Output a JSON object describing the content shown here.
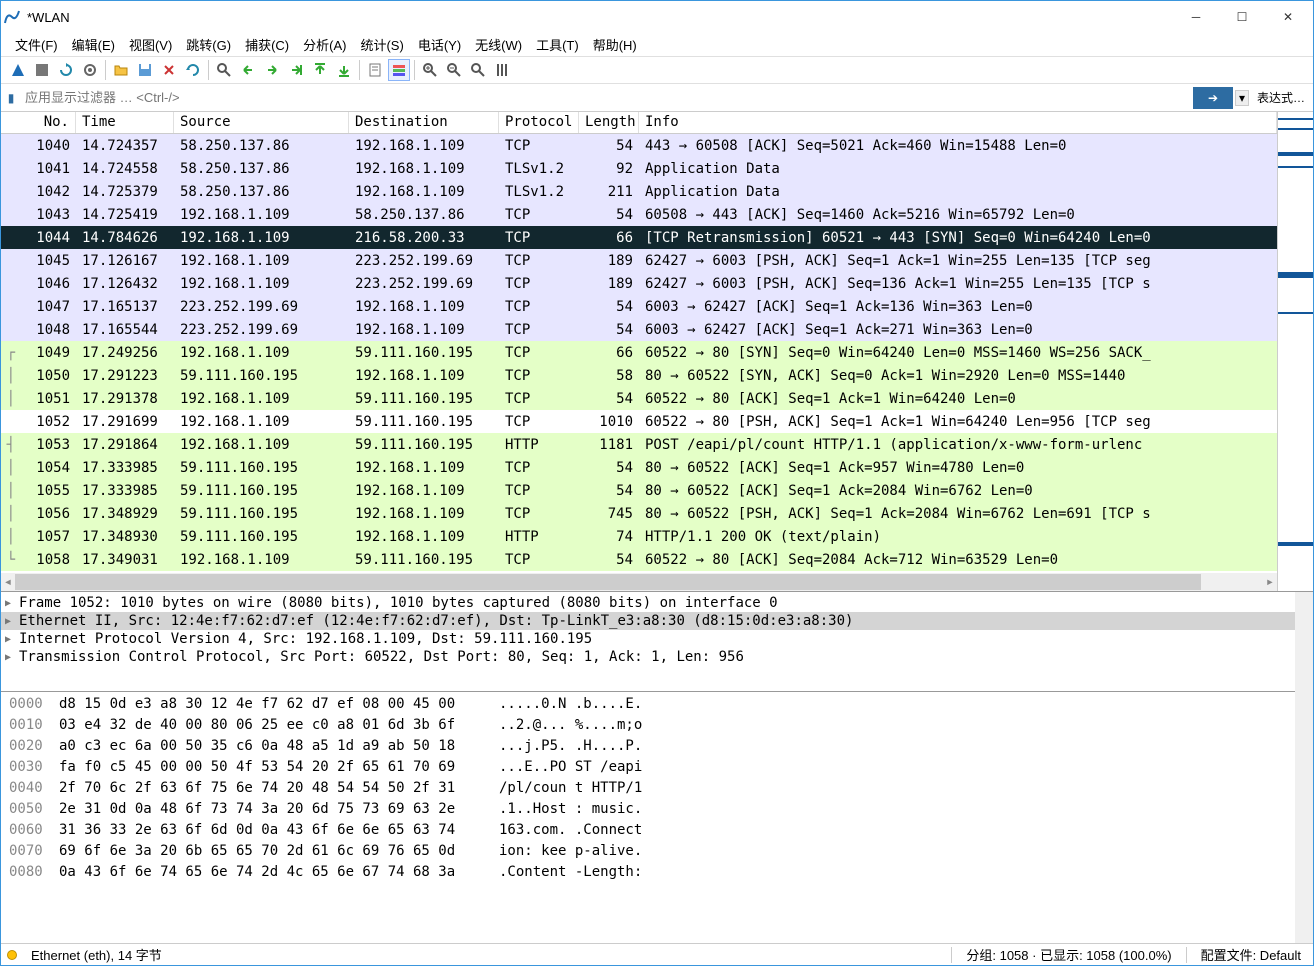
{
  "title": "*WLAN",
  "menu": [
    "文件(F)",
    "编辑(E)",
    "视图(V)",
    "跳转(G)",
    "捕获(C)",
    "分析(A)",
    "统计(S)",
    "电话(Y)",
    "无线(W)",
    "工具(T)",
    "帮助(H)"
  ],
  "filter_placeholder": "应用显示过滤器 … <Ctrl-/>",
  "expr_btn": "表达式…",
  "columns": {
    "no": "No.",
    "time": "Time",
    "src": "Source",
    "dst": "Destination",
    "proto": "Protocol",
    "len": "Length",
    "info": "Info"
  },
  "packets": [
    {
      "no": "1040",
      "time": "14.724357",
      "src": "58.250.137.86",
      "dst": "192.168.1.109",
      "proto": "TCP",
      "len": "54",
      "info": "443 → 60508 [ACK] Seq=5021 Ack=460 Win=15488 Len=0",
      "cls": "lavender"
    },
    {
      "no": "1041",
      "time": "14.724558",
      "src": "58.250.137.86",
      "dst": "192.168.1.109",
      "proto": "TLSv1.2",
      "len": "92",
      "info": "Application Data",
      "cls": "lavender"
    },
    {
      "no": "1042",
      "time": "14.725379",
      "src": "58.250.137.86",
      "dst": "192.168.1.109",
      "proto": "TLSv1.2",
      "len": "211",
      "info": "Application Data",
      "cls": "lavender"
    },
    {
      "no": "1043",
      "time": "14.725419",
      "src": "192.168.1.109",
      "dst": "58.250.137.86",
      "proto": "TCP",
      "len": "54",
      "info": "60508 → 443 [ACK] Seq=1460 Ack=5216 Win=65792 Len=0",
      "cls": "lavender"
    },
    {
      "no": "1044",
      "time": "14.784626",
      "src": "192.168.1.109",
      "dst": "216.58.200.33",
      "proto": "TCP",
      "len": "66",
      "info": "[TCP Retransmission] 60521 → 443 [SYN] Seq=0 Win=64240 Len=0",
      "cls": "selected"
    },
    {
      "no": "1045",
      "time": "17.126167",
      "src": "192.168.1.109",
      "dst": "223.252.199.69",
      "proto": "TCP",
      "len": "189",
      "info": "62427 → 6003 [PSH, ACK] Seq=1 Ack=1 Win=255 Len=135 [TCP seg",
      "cls": "lavender"
    },
    {
      "no": "1046",
      "time": "17.126432",
      "src": "192.168.1.109",
      "dst": "223.252.199.69",
      "proto": "TCP",
      "len": "189",
      "info": "62427 → 6003 [PSH, ACK] Seq=136 Ack=1 Win=255 Len=135 [TCP s",
      "cls": "lavender"
    },
    {
      "no": "1047",
      "time": "17.165137",
      "src": "223.252.199.69",
      "dst": "192.168.1.109",
      "proto": "TCP",
      "len": "54",
      "info": "6003 → 62427 [ACK] Seq=1 Ack=136 Win=363 Len=0",
      "cls": "lavender"
    },
    {
      "no": "1048",
      "time": "17.165544",
      "src": "223.252.199.69",
      "dst": "192.168.1.109",
      "proto": "TCP",
      "len": "54",
      "info": "6003 → 62427 [ACK] Seq=1 Ack=271 Win=363 Len=0",
      "cls": "lavender"
    },
    {
      "no": "1049",
      "time": "17.249256",
      "src": "192.168.1.109",
      "dst": "59.111.160.195",
      "proto": "TCP",
      "len": "66",
      "info": "60522 → 80 [SYN] Seq=0 Win=64240 Len=0 MSS=1460 WS=256 SACK_",
      "cls": "green",
      "tree": "┌"
    },
    {
      "no": "1050",
      "time": "17.291223",
      "src": "59.111.160.195",
      "dst": "192.168.1.109",
      "proto": "TCP",
      "len": "58",
      "info": "80 → 60522 [SYN, ACK] Seq=0 Ack=1 Win=2920 Len=0 MSS=1440",
      "cls": "green",
      "tree": "│"
    },
    {
      "no": "1051",
      "time": "17.291378",
      "src": "192.168.1.109",
      "dst": "59.111.160.195",
      "proto": "TCP",
      "len": "54",
      "info": "60522 → 80 [ACK] Seq=1 Ack=1 Win=64240 Len=0",
      "cls": "green",
      "tree": "│"
    },
    {
      "no": "1052",
      "time": "17.291699",
      "src": "192.168.1.109",
      "dst": "59.111.160.195",
      "proto": "TCP",
      "len": "1010",
      "info": "60522 → 80 [PSH, ACK] Seq=1 Ack=1 Win=64240 Len=956 [TCP seg",
      "cls": "white",
      "tree": ""
    },
    {
      "no": "1053",
      "time": "17.291864",
      "src": "192.168.1.109",
      "dst": "59.111.160.195",
      "proto": "HTTP",
      "len": "1181",
      "info": "POST /eapi/pl/count HTTP/1.1  (application/x-www-form-urlenc",
      "cls": "green",
      "tree": "┤"
    },
    {
      "no": "1054",
      "time": "17.333985",
      "src": "59.111.160.195",
      "dst": "192.168.1.109",
      "proto": "TCP",
      "len": "54",
      "info": "80 → 60522 [ACK] Seq=1 Ack=957 Win=4780 Len=0",
      "cls": "green",
      "tree": "│"
    },
    {
      "no": "1055",
      "time": "17.333985",
      "src": "59.111.160.195",
      "dst": "192.168.1.109",
      "proto": "TCP",
      "len": "54",
      "info": "80 → 60522 [ACK] Seq=1 Ack=2084 Win=6762 Len=0",
      "cls": "green",
      "tree": "│"
    },
    {
      "no": "1056",
      "time": "17.348929",
      "src": "59.111.160.195",
      "dst": "192.168.1.109",
      "proto": "TCP",
      "len": "745",
      "info": "80 → 60522 [PSH, ACK] Seq=1 Ack=2084 Win=6762 Len=691 [TCP s",
      "cls": "green",
      "tree": "│"
    },
    {
      "no": "1057",
      "time": "17.348930",
      "src": "59.111.160.195",
      "dst": "192.168.1.109",
      "proto": "HTTP",
      "len": "74",
      "info": "HTTP/1.1 200 OK  (text/plain)",
      "cls": "green",
      "tree": "│"
    },
    {
      "no": "1058",
      "time": "17.349031",
      "src": "192.168.1.109",
      "dst": "59.111.160.195",
      "proto": "TCP",
      "len": "54",
      "info": "60522 → 80 [ACK] Seq=2084 Ack=712 Win=63529 Len=0",
      "cls": "green",
      "tree": "└"
    }
  ],
  "details": [
    {
      "text": "Frame 1052: 1010 bytes on wire (8080 bits), 1010 bytes captured (8080 bits) on interface 0",
      "sel": false
    },
    {
      "text": "Ethernet II, Src: 12:4e:f7:62:d7:ef (12:4e:f7:62:d7:ef), Dst: Tp-LinkT_e3:a8:30 (d8:15:0d:e3:a8:30)",
      "sel": true
    },
    {
      "text": "Internet Protocol Version 4, Src: 192.168.1.109, Dst: 59.111.160.195",
      "sel": false
    },
    {
      "text": "Transmission Control Protocol, Src Port: 60522, Dst Port: 80, Seq: 1, Ack: 1, Len: 956",
      "sel": false
    }
  ],
  "bytes": [
    {
      "addr": "0000",
      "hex": "d8 15 0d e3 a8 30 12 4e  f7 62 d7 ef 08 00 45 00",
      "ascii": ".....0.N .b....E."
    },
    {
      "addr": "0010",
      "hex": "03 e4 32 de 40 00 80 06  25 ee c0 a8 01 6d 3b 6f",
      "ascii": "..2.@... %....m;o"
    },
    {
      "addr": "0020",
      "hex": "a0 c3 ec 6a 00 50 35 c6  0a 48 a5 1d a9 ab 50 18",
      "ascii": "...j.P5. .H....P."
    },
    {
      "addr": "0030",
      "hex": "fa f0 c5 45 00 00 50 4f  53 54 20 2f 65 61 70 69",
      "ascii": "...E..PO ST /eapi"
    },
    {
      "addr": "0040",
      "hex": "2f 70 6c 2f 63 6f 75 6e  74 20 48 54 54 50 2f 31",
      "ascii": "/pl/coun t HTTP/1"
    },
    {
      "addr": "0050",
      "hex": "2e 31 0d 0a 48 6f 73 74  3a 20 6d 75 73 69 63 2e",
      "ascii": ".1..Host : music."
    },
    {
      "addr": "0060",
      "hex": "31 36 33 2e 63 6f 6d 0d  0a 43 6f 6e 6e 65 63 74",
      "ascii": "163.com. .Connect"
    },
    {
      "addr": "0070",
      "hex": "69 6f 6e 3a 20 6b 65 65  70 2d 61 6c 69 76 65 0d",
      "ascii": "ion: kee p-alive."
    },
    {
      "addr": "0080",
      "hex": "0a 43 6f 6e 74 65 6e 74  2d 4c 65 6e 67 74 68 3a",
      "ascii": ".Content -Length:"
    }
  ],
  "status": {
    "left": "Ethernet (eth), 14 字节",
    "packets": "分组: 1058  ·  已显示: 1058 (100.0%)",
    "profile": "配置文件: Default"
  }
}
